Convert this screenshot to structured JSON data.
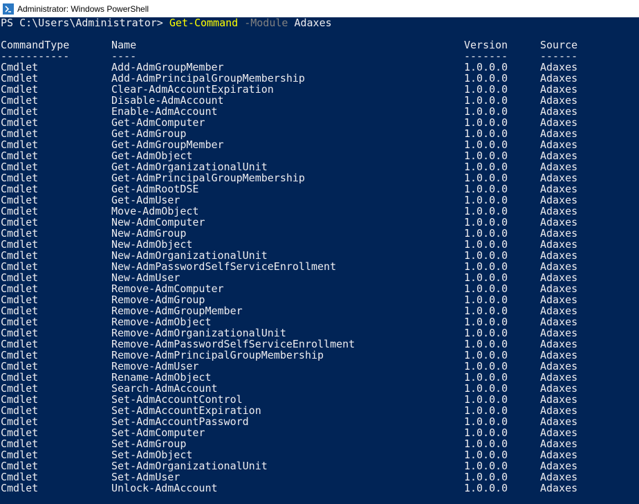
{
  "window": {
    "title": "Administrator: Windows PowerShell",
    "icon": "powershell-icon"
  },
  "colors": {
    "background": "#012456",
    "foreground": "#eeedf0",
    "command": "#ffff00",
    "parameter": "#808080"
  },
  "prompt": {
    "text": "PS C:\\Users\\Administrator> ",
    "command": "Get-Command",
    "parameter": "-Module",
    "argument": "Adaxes"
  },
  "table": {
    "headers": [
      "CommandType",
      "Name",
      "Version",
      "Source"
    ],
    "separators": [
      "-----------",
      "----",
      "-------",
      "------"
    ],
    "rows": [
      [
        "Cmdlet",
        "Add-AdmGroupMember",
        "1.0.0.0",
        "Adaxes"
      ],
      [
        "Cmdlet",
        "Add-AdmPrincipalGroupMembership",
        "1.0.0.0",
        "Adaxes"
      ],
      [
        "Cmdlet",
        "Clear-AdmAccountExpiration",
        "1.0.0.0",
        "Adaxes"
      ],
      [
        "Cmdlet",
        "Disable-AdmAccount",
        "1.0.0.0",
        "Adaxes"
      ],
      [
        "Cmdlet",
        "Enable-AdmAccount",
        "1.0.0.0",
        "Adaxes"
      ],
      [
        "Cmdlet",
        "Get-AdmComputer",
        "1.0.0.0",
        "Adaxes"
      ],
      [
        "Cmdlet",
        "Get-AdmGroup",
        "1.0.0.0",
        "Adaxes"
      ],
      [
        "Cmdlet",
        "Get-AdmGroupMember",
        "1.0.0.0",
        "Adaxes"
      ],
      [
        "Cmdlet",
        "Get-AdmObject",
        "1.0.0.0",
        "Adaxes"
      ],
      [
        "Cmdlet",
        "Get-AdmOrganizationalUnit",
        "1.0.0.0",
        "Adaxes"
      ],
      [
        "Cmdlet",
        "Get-AdmPrincipalGroupMembership",
        "1.0.0.0",
        "Adaxes"
      ],
      [
        "Cmdlet",
        "Get-AdmRootDSE",
        "1.0.0.0",
        "Adaxes"
      ],
      [
        "Cmdlet",
        "Get-AdmUser",
        "1.0.0.0",
        "Adaxes"
      ],
      [
        "Cmdlet",
        "Move-AdmObject",
        "1.0.0.0",
        "Adaxes"
      ],
      [
        "Cmdlet",
        "New-AdmComputer",
        "1.0.0.0",
        "Adaxes"
      ],
      [
        "Cmdlet",
        "New-AdmGroup",
        "1.0.0.0",
        "Adaxes"
      ],
      [
        "Cmdlet",
        "New-AdmObject",
        "1.0.0.0",
        "Adaxes"
      ],
      [
        "Cmdlet",
        "New-AdmOrganizationalUnit",
        "1.0.0.0",
        "Adaxes"
      ],
      [
        "Cmdlet",
        "New-AdmPasswordSelfServiceEnrollment",
        "1.0.0.0",
        "Adaxes"
      ],
      [
        "Cmdlet",
        "New-AdmUser",
        "1.0.0.0",
        "Adaxes"
      ],
      [
        "Cmdlet",
        "Remove-AdmComputer",
        "1.0.0.0",
        "Adaxes"
      ],
      [
        "Cmdlet",
        "Remove-AdmGroup",
        "1.0.0.0",
        "Adaxes"
      ],
      [
        "Cmdlet",
        "Remove-AdmGroupMember",
        "1.0.0.0",
        "Adaxes"
      ],
      [
        "Cmdlet",
        "Remove-AdmObject",
        "1.0.0.0",
        "Adaxes"
      ],
      [
        "Cmdlet",
        "Remove-AdmOrganizationalUnit",
        "1.0.0.0",
        "Adaxes"
      ],
      [
        "Cmdlet",
        "Remove-AdmPasswordSelfServiceEnrollment",
        "1.0.0.0",
        "Adaxes"
      ],
      [
        "Cmdlet",
        "Remove-AdmPrincipalGroupMembership",
        "1.0.0.0",
        "Adaxes"
      ],
      [
        "Cmdlet",
        "Remove-AdmUser",
        "1.0.0.0",
        "Adaxes"
      ],
      [
        "Cmdlet",
        "Rename-AdmObject",
        "1.0.0.0",
        "Adaxes"
      ],
      [
        "Cmdlet",
        "Search-AdmAccount",
        "1.0.0.0",
        "Adaxes"
      ],
      [
        "Cmdlet",
        "Set-AdmAccountControl",
        "1.0.0.0",
        "Adaxes"
      ],
      [
        "Cmdlet",
        "Set-AdmAccountExpiration",
        "1.0.0.0",
        "Adaxes"
      ],
      [
        "Cmdlet",
        "Set-AdmAccountPassword",
        "1.0.0.0",
        "Adaxes"
      ],
      [
        "Cmdlet",
        "Set-AdmComputer",
        "1.0.0.0",
        "Adaxes"
      ],
      [
        "Cmdlet",
        "Set-AdmGroup",
        "1.0.0.0",
        "Adaxes"
      ],
      [
        "Cmdlet",
        "Set-AdmObject",
        "1.0.0.0",
        "Adaxes"
      ],
      [
        "Cmdlet",
        "Set-AdmOrganizationalUnit",
        "1.0.0.0",
        "Adaxes"
      ],
      [
        "Cmdlet",
        "Set-AdmUser",
        "1.0.0.0",
        "Adaxes"
      ],
      [
        "Cmdlet",
        "Unlock-AdmAccount",
        "1.0.0.0",
        "Adaxes"
      ]
    ]
  }
}
